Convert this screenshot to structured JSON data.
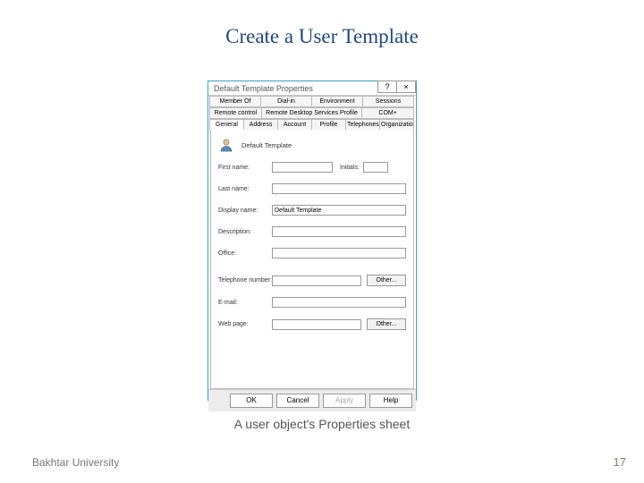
{
  "slide": {
    "title": "Create a User Template",
    "caption": "A user object's Properties sheet",
    "footer_left": "Bakhtar University",
    "page_number": "17"
  },
  "dialog": {
    "title": "Default Template Properties",
    "titlebar": {
      "help": "?",
      "close": "×"
    },
    "tab_rows": [
      [
        "Member Of",
        "Dial-in",
        "Environment",
        "Sessions"
      ],
      [
        "Remote control",
        "Remote Desktop Services Profile",
        "COM+"
      ],
      [
        "General",
        "Address",
        "Account",
        "Profile",
        "Telephones",
        "Organization"
      ]
    ],
    "active_tab": "General",
    "user_display": "Default Template",
    "fields": {
      "first_name": {
        "label": "First name:",
        "value": ""
      },
      "initials": {
        "label": "Initials:",
        "value": ""
      },
      "last_name": {
        "label": "Last name:",
        "value": ""
      },
      "display_name": {
        "label": "Display name:",
        "value": "Default Template"
      },
      "description": {
        "label": "Description:",
        "value": ""
      },
      "office": {
        "label": "Office:",
        "value": ""
      },
      "telephone": {
        "label": "Telephone number:",
        "value": ""
      },
      "email": {
        "label": "E-mail:",
        "value": ""
      },
      "web_page": {
        "label": "Web page:",
        "value": ""
      },
      "other_btn": "Other..."
    },
    "buttons": {
      "ok": "OK",
      "cancel": "Cancel",
      "apply": "Apply",
      "help": "Help"
    }
  }
}
